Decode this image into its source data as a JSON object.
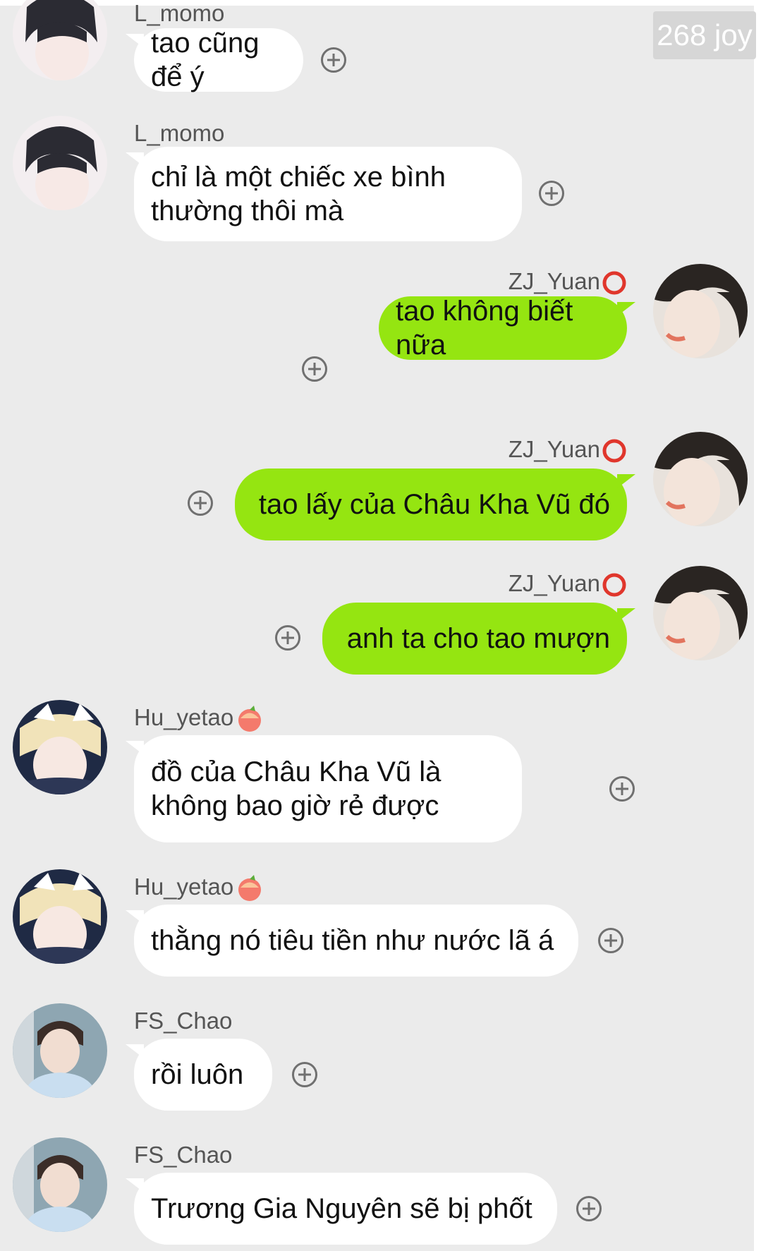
{
  "watermark": "268 joy",
  "messages": [
    {
      "sender": "L_momo",
      "text": "tao cũng để ý",
      "side": "left"
    },
    {
      "sender": "L_momo",
      "text": "chỉ là một chiếc xe bình thường thôi mà",
      "side": "left"
    },
    {
      "sender": "ZJ_Yuan",
      "badge": "red-circle-icon",
      "text": "tao không biết nữa",
      "side": "right"
    },
    {
      "sender": "ZJ_Yuan",
      "badge": "red-circle-icon",
      "text": "tao lấy của Châu Kha Vũ đó",
      "side": "right"
    },
    {
      "sender": "ZJ_Yuan",
      "badge": "red-circle-icon",
      "text": "anh ta cho tao mượn",
      "side": "right"
    },
    {
      "sender": "Hu_yetao",
      "badge": "peach-emoji-icon",
      "text": "đồ của Châu Kha Vũ là không bao giờ rẻ được",
      "side": "left"
    },
    {
      "sender": "Hu_yetao",
      "badge": "peach-emoji-icon",
      "text": "thằng nó tiêu tiền như nước lã á",
      "side": "left"
    },
    {
      "sender": "FS_Chao",
      "text": "rồi luôn",
      "side": "left"
    },
    {
      "sender": "FS_Chao",
      "text": "Trương Gia Nguyên sẽ bị phốt",
      "side": "left"
    }
  ],
  "colors": {
    "background": "#ebebeb",
    "incoming_bubble": "#ffffff",
    "outgoing_bubble": "#95e511",
    "badge_red": "#e0362c",
    "watermark_bg": "#d6d6d6"
  }
}
